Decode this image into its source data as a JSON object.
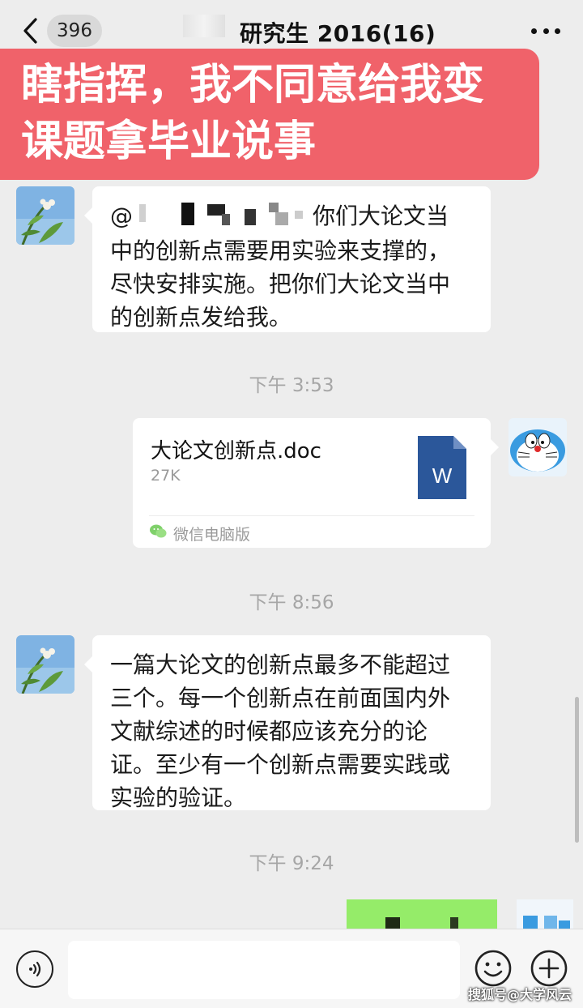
{
  "header": {
    "unread_count": "396",
    "title": "研究生 2016(16)"
  },
  "caption": {
    "line1": "瞎指挥，我不同意给我变",
    "line2": "课题拿毕业说事"
  },
  "messages": [
    {
      "type": "text",
      "side": "left",
      "mention_prefix": "@",
      "text_after_mention": "你们大论文当",
      "text_rest": "中的创新点需要用实验来支撑的，\n尽快安排实施。把你们大论文当中\n的创新点发给我。"
    },
    {
      "type": "timestamp",
      "text": "下午 3:53"
    },
    {
      "type": "file",
      "side": "right",
      "file_name": "大论文创新点.doc",
      "file_size": "27K",
      "file_icon": "word-doc-icon",
      "file_icon_letter": "W",
      "source": "微信电脑版"
    },
    {
      "type": "timestamp",
      "text": "下午 8:56"
    },
    {
      "type": "text",
      "side": "left",
      "text": "一篇大论文的创新点最多不能超过\n三个。每一个创新点在前面国内外\n文献综述的时候都应该充分的论\n证。至少有一个创新点需要实践或\n实验的验证。"
    },
    {
      "type": "timestamp",
      "text": "下午 9:24"
    }
  ],
  "input_bar": {
    "placeholder": ""
  },
  "watermark": "搜狐号@大学风云",
  "colors": {
    "caption_bg": "#f0626a",
    "chat_bg": "#ededed",
    "word_blue": "#2b579a",
    "self_bubble_green": "#95ec69"
  }
}
